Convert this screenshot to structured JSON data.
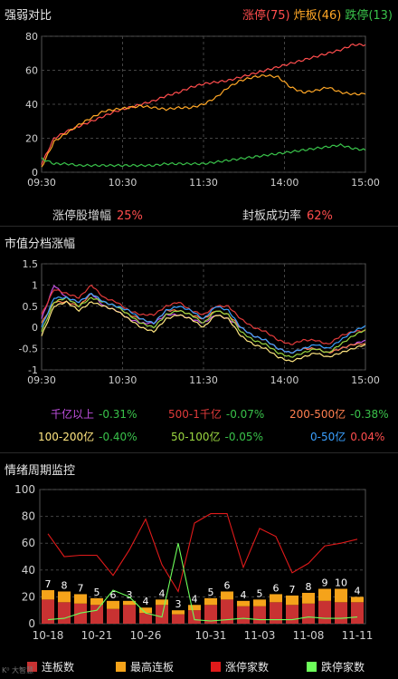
{
  "panel1": {
    "title": "强弱对比",
    "legend": [
      {
        "label": "涨停(75)",
        "color": "#ff4d4d"
      },
      {
        "label": "炸板(46)",
        "color": "#ffa726"
      },
      {
        "label": "跌停(13)",
        "color": "#39c24a"
      }
    ],
    "stats": {
      "growth_label": "涨停股增幅",
      "growth_value": "25%",
      "seal_label": "封板成功率",
      "seal_value": "62%"
    }
  },
  "panel2": {
    "title": "市值分档涨幅",
    "groups": [
      {
        "label": "千亿以上",
        "value": "-0.31%",
        "color": "#c050e0"
      },
      {
        "label": "500-1千亿",
        "value": "-0.07%",
        "color": "#e03a3a"
      },
      {
        "label": "200-500亿",
        "value": "-0.38%",
        "color": "#ff7f50"
      },
      {
        "label": "100-200亿",
        "value": "-0.40%",
        "color": "#ffe680"
      },
      {
        "label": "50-100亿",
        "value": "-0.05%",
        "color": "#9ad640"
      },
      {
        "label": "0-50亿",
        "value": "0.04%",
        "color": "#3aa0ff"
      }
    ]
  },
  "panel3": {
    "title": "情绪周期监控",
    "legend": [
      {
        "label": "连板数",
        "color": "#c83232"
      },
      {
        "label": "最高连板",
        "color": "#f5a31a"
      },
      {
        "label": "涨停家数",
        "color": "#e01a1a"
      },
      {
        "label": "跌停家数",
        "color": "#6dff5a"
      }
    ]
  },
  "watermark": "K⁰ 大智慧",
  "chart_data": [
    {
      "type": "line",
      "title": "强弱对比",
      "x_ticks": [
        "09:30",
        "10:30",
        "11:30",
        "14:00",
        "15:00"
      ],
      "ylim": [
        0,
        80
      ],
      "y_ticks": [
        0,
        20,
        40,
        60,
        80
      ],
      "series": [
        {
          "name": "涨停",
          "color": "#ff4d4d",
          "values": [
            5,
            20,
            24,
            27,
            30,
            33,
            36,
            38,
            40,
            42,
            45,
            47,
            50,
            52,
            53,
            54,
            56,
            58,
            60,
            62,
            64,
            66,
            68,
            70,
            72,
            75,
            75
          ]
        },
        {
          "name": "炸板",
          "color": "#ffa726",
          "values": [
            3,
            18,
            23,
            28,
            32,
            36,
            37,
            38,
            39,
            38,
            37,
            38,
            38,
            40,
            44,
            50,
            54,
            56,
            57,
            56,
            50,
            47,
            48,
            50,
            47,
            46,
            46
          ]
        },
        {
          "name": "跌停",
          "color": "#39c24a",
          "values": [
            8,
            5,
            5,
            4,
            4,
            4,
            4,
            4,
            4,
            4,
            5,
            5,
            5,
            5,
            6,
            7,
            8,
            9,
            10,
            11,
            12,
            13,
            14,
            15,
            16,
            14,
            13
          ]
        }
      ]
    },
    {
      "type": "line",
      "title": "市值分档涨幅",
      "x_ticks": [
        "09:30",
        "10:30",
        "11:30",
        "14:00",
        "15:00"
      ],
      "ylim": [
        -1,
        1.5
      ],
      "y_ticks": [
        -1,
        -0.5,
        0,
        0.5,
        1,
        1.5
      ],
      "series": [
        {
          "name": "千亿以上",
          "color": "#c050e0",
          "values": [
            0.2,
            1.0,
            0.7,
            0.6,
            0.8,
            0.5,
            0.4,
            0.2,
            0.1,
            0.1,
            0.3,
            0.3,
            0.2,
            0.1,
            0.3,
            0.2,
            0.0,
            -0.2,
            -0.3,
            -0.5,
            -0.6,
            -0.5,
            -0.5,
            -0.6,
            -0.5,
            -0.4,
            -0.3
          ]
        },
        {
          "name": "500-1千亿",
          "color": "#e03a3a",
          "values": [
            0.3,
            0.9,
            0.8,
            0.7,
            1.0,
            0.7,
            0.6,
            0.4,
            0.3,
            0.3,
            0.5,
            0.6,
            0.4,
            0.3,
            0.5,
            0.5,
            0.2,
            0.0,
            -0.1,
            -0.3,
            -0.4,
            -0.3,
            -0.3,
            -0.4,
            -0.2,
            -0.1,
            -0.07
          ]
        },
        {
          "name": "200-500亿",
          "color": "#ff7f50",
          "values": [
            0.1,
            0.6,
            0.6,
            0.5,
            0.8,
            0.6,
            0.5,
            0.3,
            0.2,
            0.1,
            0.4,
            0.4,
            0.3,
            0.2,
            0.4,
            0.3,
            0.0,
            -0.2,
            -0.3,
            -0.5,
            -0.6,
            -0.5,
            -0.5,
            -0.6,
            -0.5,
            -0.4,
            -0.38
          ]
        },
        {
          "name": "100-200亿",
          "color": "#ffe680",
          "values": [
            -0.2,
            0.5,
            0.6,
            0.4,
            0.6,
            0.5,
            0.4,
            0.2,
            0.0,
            -0.1,
            0.2,
            0.3,
            0.2,
            0.0,
            0.3,
            0.2,
            -0.2,
            -0.4,
            -0.5,
            -0.7,
            -0.8,
            -0.7,
            -0.6,
            -0.7,
            -0.6,
            -0.5,
            -0.4
          ]
        },
        {
          "name": "50-100亿",
          "color": "#9ad640",
          "values": [
            -0.1,
            0.6,
            0.7,
            0.5,
            0.7,
            0.6,
            0.5,
            0.3,
            0.1,
            0.0,
            0.3,
            0.4,
            0.3,
            0.1,
            0.4,
            0.3,
            -0.1,
            -0.3,
            -0.4,
            -0.6,
            -0.7,
            -0.6,
            -0.5,
            -0.6,
            -0.4,
            -0.2,
            -0.05
          ]
        },
        {
          "name": "0-50亿",
          "color": "#3aa0ff",
          "values": [
            0.0,
            0.7,
            0.7,
            0.6,
            0.8,
            0.6,
            0.5,
            0.4,
            0.2,
            0.1,
            0.4,
            0.5,
            0.4,
            0.2,
            0.5,
            0.4,
            0.0,
            -0.2,
            -0.3,
            -0.5,
            -0.6,
            -0.5,
            -0.4,
            -0.5,
            -0.3,
            -0.1,
            0.04
          ]
        }
      ]
    },
    {
      "type": "bar",
      "title": "情绪周期监控",
      "ylim": [
        0,
        100
      ],
      "y_ticks": [
        0,
        20,
        40,
        60,
        80,
        100
      ],
      "x_ticks": [
        "10-18",
        "10-21",
        "10-26",
        "10-31",
        "11-03",
        "11-08",
        "11-11"
      ],
      "categories": [
        "10-18",
        "10-19",
        "10-20",
        "10-21",
        "10-22",
        "10-25",
        "10-26",
        "10-27",
        "10-28",
        "10-29",
        "10-31",
        "11-01",
        "11-02",
        "11-03",
        "11-04",
        "11-05",
        "11-08",
        "11-09",
        "11-10",
        "11-11"
      ],
      "series": [
        {
          "name": "连板数",
          "color": "#c83232",
          "values": [
            18,
            16,
            15,
            14,
            11,
            14,
            8,
            14,
            7,
            10,
            14,
            18,
            13,
            13,
            16,
            14,
            15,
            17,
            16,
            16
          ]
        },
        {
          "name": "最高连板",
          "color": "#f5a31a",
          "values": [
            7,
            8,
            7,
            5,
            6,
            3,
            4,
            4,
            3,
            4,
            5,
            6,
            4,
            5,
            6,
            7,
            8,
            9,
            10,
            4
          ]
        },
        {
          "name": "涨停家数",
          "color": "#e01a1a",
          "values": [
            67,
            50,
            51,
            51,
            36,
            55,
            78,
            44,
            24,
            75,
            82,
            82,
            42,
            71,
            65,
            38,
            45,
            58,
            60,
            63
          ]
        },
        {
          "name": "跌停家数",
          "color": "#6dff5a",
          "values": [
            3,
            4,
            8,
            10,
            25,
            20,
            8,
            5,
            60,
            3,
            2,
            3,
            4,
            3,
            3,
            3,
            5,
            4,
            4,
            5
          ]
        }
      ],
      "bar_labels": [
        7,
        8,
        7,
        5,
        6,
        3,
        4,
        4,
        3,
        4,
        5,
        6,
        4,
        5,
        6,
        7,
        8,
        9,
        10,
        4
      ]
    }
  ]
}
